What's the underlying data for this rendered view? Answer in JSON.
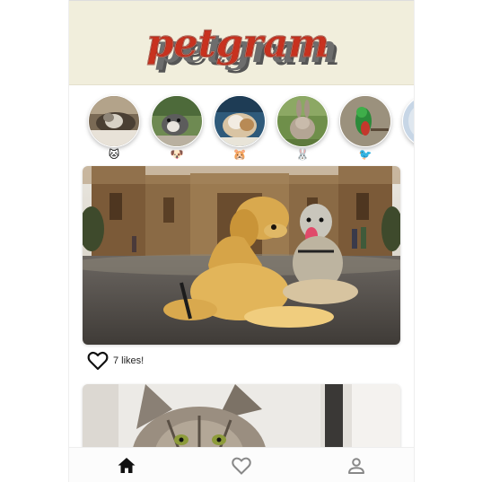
{
  "app": {
    "brand": "petgram"
  },
  "stories": [
    {
      "emoji": "🐱",
      "icon": "cat-story"
    },
    {
      "emoji": "🐶",
      "icon": "dog-story"
    },
    {
      "emoji": "🐹",
      "icon": "hamster-story"
    },
    {
      "emoji": "🐰",
      "icon": "rabbit-story"
    },
    {
      "emoji": "🐦",
      "icon": "bird-story"
    }
  ],
  "posts": [
    {
      "likes_text": "7 likes!"
    }
  ],
  "nav": {
    "items": [
      "home-icon",
      "favorites-icon",
      "user-icon"
    ]
  },
  "colors": {
    "header_bg": "#f1eedc",
    "logo_red": "#c8321f",
    "logo_shadow": "#555555"
  }
}
